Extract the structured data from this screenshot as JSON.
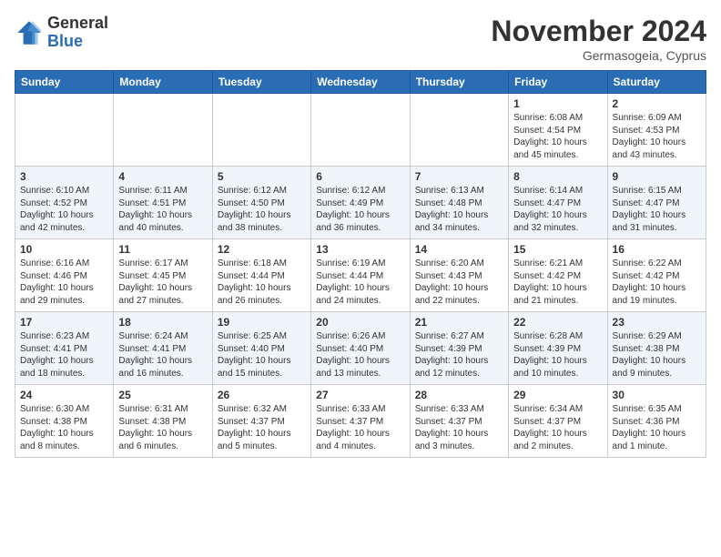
{
  "header": {
    "logo_general": "General",
    "logo_blue": "Blue",
    "month_title": "November 2024",
    "location": "Germasogeia, Cyprus"
  },
  "days_of_week": [
    "Sunday",
    "Monday",
    "Tuesday",
    "Wednesday",
    "Thursday",
    "Friday",
    "Saturday"
  ],
  "weeks": [
    [
      {
        "day": "",
        "info": ""
      },
      {
        "day": "",
        "info": ""
      },
      {
        "day": "",
        "info": ""
      },
      {
        "day": "",
        "info": ""
      },
      {
        "day": "",
        "info": ""
      },
      {
        "day": "1",
        "info": "Sunrise: 6:08 AM\nSunset: 4:54 PM\nDaylight: 10 hours\nand 45 minutes."
      },
      {
        "day": "2",
        "info": "Sunrise: 6:09 AM\nSunset: 4:53 PM\nDaylight: 10 hours\nand 43 minutes."
      }
    ],
    [
      {
        "day": "3",
        "info": "Sunrise: 6:10 AM\nSunset: 4:52 PM\nDaylight: 10 hours\nand 42 minutes."
      },
      {
        "day": "4",
        "info": "Sunrise: 6:11 AM\nSunset: 4:51 PM\nDaylight: 10 hours\nand 40 minutes."
      },
      {
        "day": "5",
        "info": "Sunrise: 6:12 AM\nSunset: 4:50 PM\nDaylight: 10 hours\nand 38 minutes."
      },
      {
        "day": "6",
        "info": "Sunrise: 6:12 AM\nSunset: 4:49 PM\nDaylight: 10 hours\nand 36 minutes."
      },
      {
        "day": "7",
        "info": "Sunrise: 6:13 AM\nSunset: 4:48 PM\nDaylight: 10 hours\nand 34 minutes."
      },
      {
        "day": "8",
        "info": "Sunrise: 6:14 AM\nSunset: 4:47 PM\nDaylight: 10 hours\nand 32 minutes."
      },
      {
        "day": "9",
        "info": "Sunrise: 6:15 AM\nSunset: 4:47 PM\nDaylight: 10 hours\nand 31 minutes."
      }
    ],
    [
      {
        "day": "10",
        "info": "Sunrise: 6:16 AM\nSunset: 4:46 PM\nDaylight: 10 hours\nand 29 minutes."
      },
      {
        "day": "11",
        "info": "Sunrise: 6:17 AM\nSunset: 4:45 PM\nDaylight: 10 hours\nand 27 minutes."
      },
      {
        "day": "12",
        "info": "Sunrise: 6:18 AM\nSunset: 4:44 PM\nDaylight: 10 hours\nand 26 minutes."
      },
      {
        "day": "13",
        "info": "Sunrise: 6:19 AM\nSunset: 4:44 PM\nDaylight: 10 hours\nand 24 minutes."
      },
      {
        "day": "14",
        "info": "Sunrise: 6:20 AM\nSunset: 4:43 PM\nDaylight: 10 hours\nand 22 minutes."
      },
      {
        "day": "15",
        "info": "Sunrise: 6:21 AM\nSunset: 4:42 PM\nDaylight: 10 hours\nand 21 minutes."
      },
      {
        "day": "16",
        "info": "Sunrise: 6:22 AM\nSunset: 4:42 PM\nDaylight: 10 hours\nand 19 minutes."
      }
    ],
    [
      {
        "day": "17",
        "info": "Sunrise: 6:23 AM\nSunset: 4:41 PM\nDaylight: 10 hours\nand 18 minutes."
      },
      {
        "day": "18",
        "info": "Sunrise: 6:24 AM\nSunset: 4:41 PM\nDaylight: 10 hours\nand 16 minutes."
      },
      {
        "day": "19",
        "info": "Sunrise: 6:25 AM\nSunset: 4:40 PM\nDaylight: 10 hours\nand 15 minutes."
      },
      {
        "day": "20",
        "info": "Sunrise: 6:26 AM\nSunset: 4:40 PM\nDaylight: 10 hours\nand 13 minutes."
      },
      {
        "day": "21",
        "info": "Sunrise: 6:27 AM\nSunset: 4:39 PM\nDaylight: 10 hours\nand 12 minutes."
      },
      {
        "day": "22",
        "info": "Sunrise: 6:28 AM\nSunset: 4:39 PM\nDaylight: 10 hours\nand 10 minutes."
      },
      {
        "day": "23",
        "info": "Sunrise: 6:29 AM\nSunset: 4:38 PM\nDaylight: 10 hours\nand 9 minutes."
      }
    ],
    [
      {
        "day": "24",
        "info": "Sunrise: 6:30 AM\nSunset: 4:38 PM\nDaylight: 10 hours\nand 8 minutes."
      },
      {
        "day": "25",
        "info": "Sunrise: 6:31 AM\nSunset: 4:38 PM\nDaylight: 10 hours\nand 6 minutes."
      },
      {
        "day": "26",
        "info": "Sunrise: 6:32 AM\nSunset: 4:37 PM\nDaylight: 10 hours\nand 5 minutes."
      },
      {
        "day": "27",
        "info": "Sunrise: 6:33 AM\nSunset: 4:37 PM\nDaylight: 10 hours\nand 4 minutes."
      },
      {
        "day": "28",
        "info": "Sunrise: 6:33 AM\nSunset: 4:37 PM\nDaylight: 10 hours\nand 3 minutes."
      },
      {
        "day": "29",
        "info": "Sunrise: 6:34 AM\nSunset: 4:37 PM\nDaylight: 10 hours\nand 2 minutes."
      },
      {
        "day": "30",
        "info": "Sunrise: 6:35 AM\nSunset: 4:36 PM\nDaylight: 10 hours\nand 1 minute."
      }
    ]
  ]
}
